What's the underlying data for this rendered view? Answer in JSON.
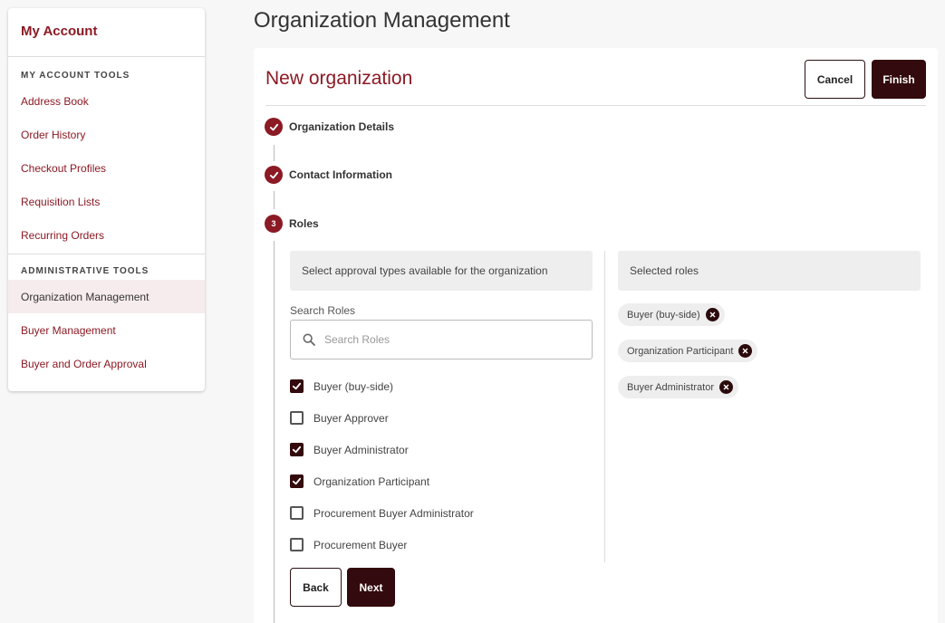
{
  "sidebar": {
    "title": "My Account",
    "sections": [
      {
        "heading": "MY ACCOUNT TOOLS",
        "items": [
          "Address Book",
          "Order History",
          "Checkout Profiles",
          "Requisition Lists",
          "Recurring Orders"
        ]
      },
      {
        "heading": "ADMINISTRATIVE TOOLS",
        "items": [
          "Organization Management",
          "Buyer Management",
          "Buyer and Order Approval"
        ]
      }
    ],
    "active_item": "Organization Management"
  },
  "page": {
    "title": "Organization Management"
  },
  "card": {
    "title": "New organization",
    "cancel_label": "Cancel",
    "finish_label": "Finish"
  },
  "steps": [
    {
      "label": "Organization Details",
      "status": "done"
    },
    {
      "label": "Contact Information",
      "status": "done"
    },
    {
      "label": "Roles",
      "number": "3",
      "status": "current"
    }
  ],
  "roles": {
    "left_header": "Select approval types available for the organization",
    "right_header": "Selected roles",
    "search_label": "Search Roles",
    "search_placeholder": "Search Roles",
    "search_value": "",
    "options": [
      {
        "label": "Buyer (buy-side)",
        "checked": true
      },
      {
        "label": "Buyer Approver",
        "checked": false
      },
      {
        "label": "Buyer Administrator",
        "checked": true
      },
      {
        "label": "Organization Participant",
        "checked": true
      },
      {
        "label": "Procurement Buyer Administrator",
        "checked": false
      },
      {
        "label": "Procurement Buyer",
        "checked": false
      }
    ],
    "selected": [
      "Buyer (buy-side)",
      "Organization Participant",
      "Buyer Administrator"
    ],
    "back_label": "Back",
    "next_label": "Next"
  },
  "colors": {
    "brand": "#8b1a24",
    "dark_button": "#330a0d"
  }
}
